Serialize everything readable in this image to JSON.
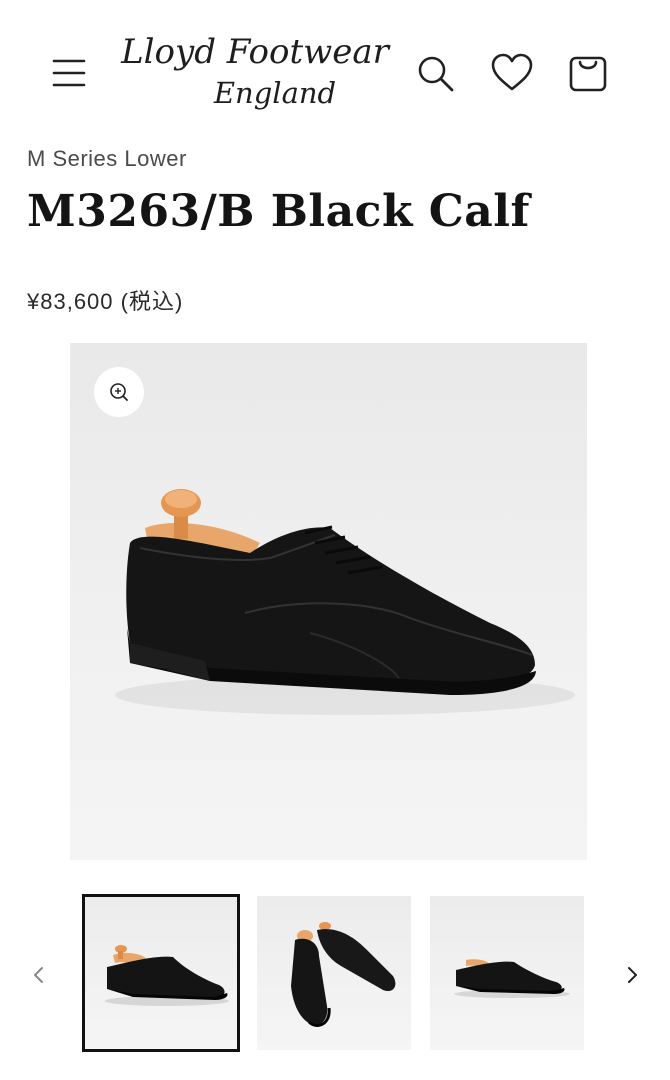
{
  "header": {
    "logo_line1": "Lloyd Footwear",
    "logo_line2": "England",
    "menu_icon": "hamburger-menu-icon",
    "search_icon": "search-icon",
    "wishlist_icon": "heart-icon",
    "cart_icon": "shopping-bag-icon"
  },
  "product": {
    "series": "M Series Lower",
    "title": "M3263/B Black Calf",
    "price": "¥83,600 (税込)"
  },
  "gallery": {
    "zoom_icon": "zoom-in-icon",
    "prev_icon": "chevron-left-icon",
    "next_icon": "chevron-right-icon",
    "thumbnails": [
      "side-view",
      "pair-front-view",
      "side-view-far"
    ],
    "active_index": 0
  },
  "colors": {
    "text": "#1b1b1b",
    "price": "#2a2a2a",
    "active_border": "#111111",
    "image_bg": "#eeeeee"
  }
}
